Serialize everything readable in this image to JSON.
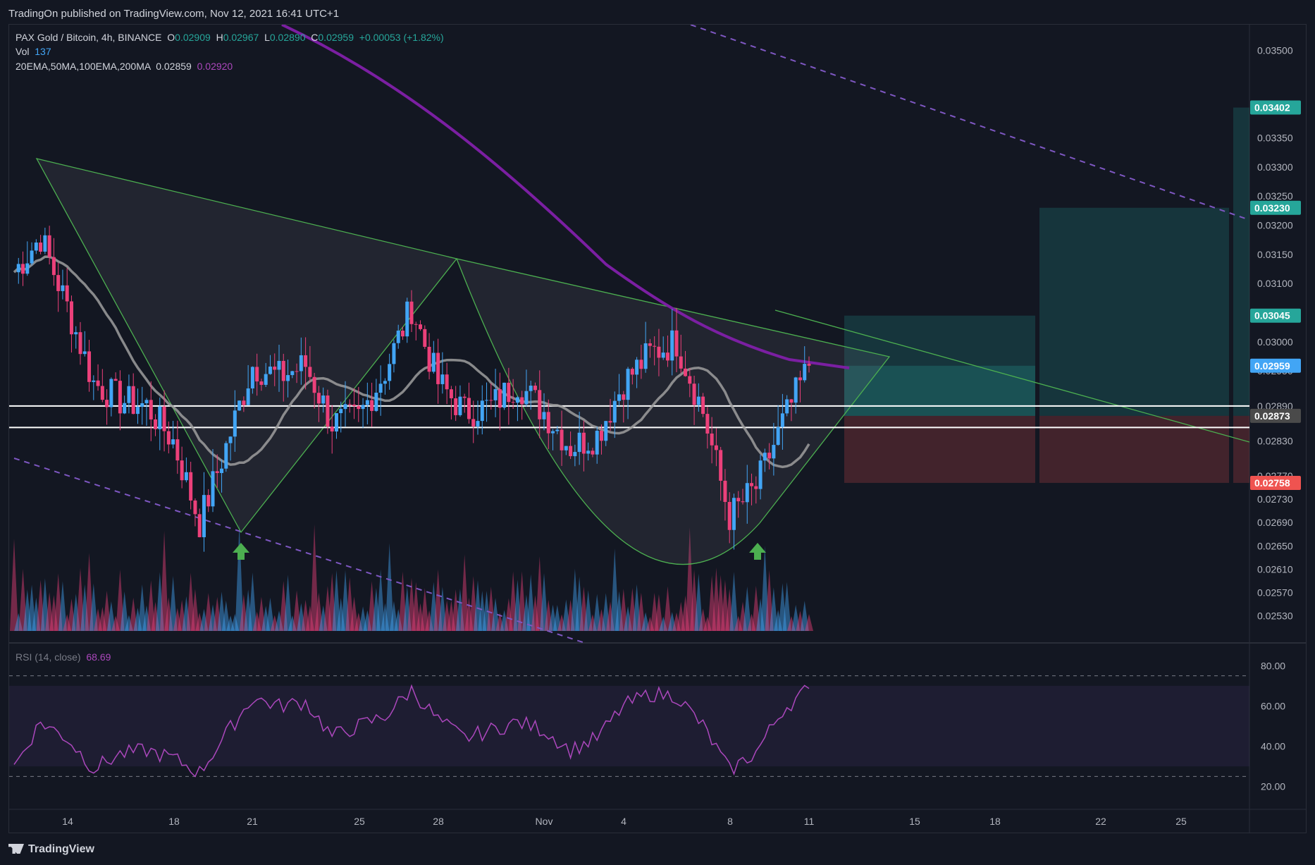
{
  "header": {
    "published": "TradingOn published on TradingView.com, Nov 12, 2021 16:41 UTC+1"
  },
  "legend": {
    "symbol": "PAX Gold / Bitcoin, 4h, BINANCE",
    "o_label": "O",
    "o_value": "0.02909",
    "h_label": "H",
    "h_value": "0.02967",
    "l_label": "L",
    "l_value": "0.02890",
    "c_label": "C",
    "c_value": "0.02959",
    "change": "+0.00053 (+1.82%)",
    "vol_label": "Vol",
    "vol_value": "137",
    "ma_label": "20EMA,50MA,100EMA,200MA",
    "ma_value1": "0.02859",
    "ma_value2": "0.02920",
    "rsi_label": "RSI (14, close)",
    "rsi_value": "68.69"
  },
  "colors": {
    "background": "#131722",
    "up_candle": "#42a5f5",
    "down_candle": "#ec407a",
    "ma200": "#7b1fa2",
    "ma50": "#9e9e9e",
    "triangle_line": "#4caf50",
    "channel_line": "#7e57c2",
    "rsi_line": "#ab47bc",
    "target_zone": "#26a69a",
    "stop_zone": "#ef5350",
    "support_line": "#ffffff",
    "arrow": "#4caf50"
  },
  "price_axis": {
    "ticks": [
      "0.03500",
      "0.03350",
      "0.03300",
      "0.03250",
      "0.03200",
      "0.03150",
      "0.03100",
      "0.03000",
      "0.02950",
      "0.02890",
      "0.02830",
      "0.02770",
      "0.02730",
      "0.02690",
      "0.02650",
      "0.02610",
      "0.02570",
      "0.02530"
    ],
    "tags": [
      {
        "label": "0.03402",
        "value": 0.03402,
        "color": "#26a69a"
      },
      {
        "label": "0.03230",
        "value": 0.0323,
        "color": "#26a69a"
      },
      {
        "label": "0.03045",
        "value": 0.03045,
        "color": "#26a69a"
      },
      {
        "label": "0.02959",
        "value": 0.02959,
        "color": "#42a5f5"
      },
      {
        "label": "0.02873",
        "value": 0.02873,
        "color": "#4a4a4a"
      },
      {
        "label": "0.02758",
        "value": 0.02758,
        "color": "#ef5350"
      }
    ]
  },
  "rsi_axis": {
    "ticks": [
      "80.00",
      "60.00",
      "40.00",
      "20.00"
    ]
  },
  "time_axis": {
    "ticks": [
      "14",
      "18",
      "21",
      "25",
      "28",
      "Nov",
      "4",
      "8",
      "11",
      "15",
      "18",
      "22",
      "25"
    ]
  },
  "footer": {
    "brand": "TradingView"
  },
  "chart_data": {
    "type": "candlestick",
    "title": "PAX Gold / Bitcoin, 4h, BINANCE",
    "ylim": [
      0.0251,
      0.0352
    ],
    "support_levels": [
      0.0289,
      0.02853
    ],
    "long_position": {
      "entry": 0.02873,
      "target1": 0.03045,
      "target2": 0.0323,
      "target3": 0.03402,
      "stop": 0.02758
    },
    "daily_closes_approx": [
      {
        "x": "Oct 13",
        "close": 0.0312
      },
      {
        "x": "Oct 14",
        "close": 0.0318
      },
      {
        "x": "Oct 15",
        "close": 0.0306
      },
      {
        "x": "Oct 16",
        "close": 0.0293
      },
      {
        "x": "Oct 17",
        "close": 0.029
      },
      {
        "x": "Oct 18",
        "close": 0.0289
      },
      {
        "x": "Oct 19",
        "close": 0.0283
      },
      {
        "x": "Oct 20",
        "close": 0.0269
      },
      {
        "x": "Oct 21",
        "close": 0.0282
      },
      {
        "x": "Oct 22",
        "close": 0.0296
      },
      {
        "x": "Oct 23",
        "close": 0.0294
      },
      {
        "x": "Oct 24",
        "close": 0.0296
      },
      {
        "x": "Oct 25",
        "close": 0.0286
      },
      {
        "x": "Oct 26",
        "close": 0.0287
      },
      {
        "x": "Oct 27",
        "close": 0.0295
      },
      {
        "x": "Oct 28",
        "close": 0.0306
      },
      {
        "x": "Oct 29",
        "close": 0.0293
      },
      {
        "x": "Oct 30",
        "close": 0.0288
      },
      {
        "x": "Oct 31",
        "close": 0.0289
      },
      {
        "x": "Nov 1",
        "close": 0.0293
      },
      {
        "x": "Nov 2",
        "close": 0.0288
      },
      {
        "x": "Nov 3",
        "close": 0.0282
      },
      {
        "x": "Nov 4",
        "close": 0.0284
      },
      {
        "x": "Nov 5",
        "close": 0.0293
      },
      {
        "x": "Nov 6",
        "close": 0.0298
      },
      {
        "x": "Nov 7",
        "close": 0.03
      },
      {
        "x": "Nov 8",
        "close": 0.0288
      },
      {
        "x": "Nov 9",
        "close": 0.027
      },
      {
        "x": "Nov 10",
        "close": 0.0275
      },
      {
        "x": "Nov 11",
        "close": 0.0286
      },
      {
        "x": "Nov 12",
        "close": 0.02959
      }
    ],
    "rsi_approx": [
      {
        "x": "Oct 13",
        "value": 30
      },
      {
        "x": "Oct 14",
        "value": 52
      },
      {
        "x": "Oct 15",
        "value": 44
      },
      {
        "x": "Oct 16",
        "value": 29
      },
      {
        "x": "Oct 17",
        "value": 36
      },
      {
        "x": "Oct 18",
        "value": 38
      },
      {
        "x": "Oct 19",
        "value": 34
      },
      {
        "x": "Oct 20",
        "value": 27
      },
      {
        "x": "Oct 21",
        "value": 46
      },
      {
        "x": "Oct 22",
        "value": 64
      },
      {
        "x": "Oct 23",
        "value": 60
      },
      {
        "x": "Oct 24",
        "value": 62
      },
      {
        "x": "Oct 25",
        "value": 45
      },
      {
        "x": "Oct 26",
        "value": 50
      },
      {
        "x": "Oct 27",
        "value": 55
      },
      {
        "x": "Oct 28",
        "value": 68
      },
      {
        "x": "Oct 29",
        "value": 53
      },
      {
        "x": "Oct 30",
        "value": 44
      },
      {
        "x": "Oct 31",
        "value": 48
      },
      {
        "x": "Nov 1",
        "value": 52
      },
      {
        "x": "Nov 2",
        "value": 48
      },
      {
        "x": "Nov 3",
        "value": 38
      },
      {
        "x": "Nov 4",
        "value": 44
      },
      {
        "x": "Nov 5",
        "value": 60
      },
      {
        "x": "Nov 6",
        "value": 66
      },
      {
        "x": "Nov 7",
        "value": 65
      },
      {
        "x": "Nov 8",
        "value": 50
      },
      {
        "x": "Nov 9",
        "value": 28
      },
      {
        "x": "Nov 10",
        "value": 37
      },
      {
        "x": "Nov 11",
        "value": 58
      },
      {
        "x": "Nov 12",
        "value": 68.69
      }
    ]
  }
}
